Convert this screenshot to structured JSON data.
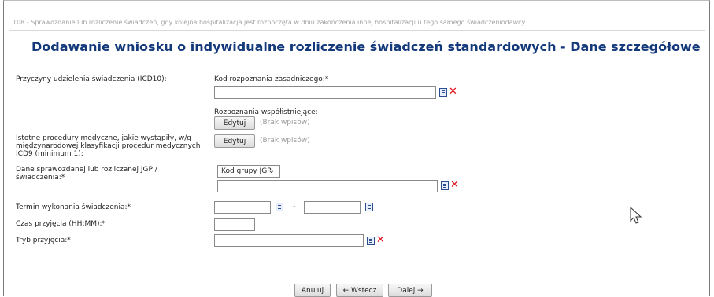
{
  "breadcrumb": "108 - Sprawozdanie lub rozliczenie świadczeń, gdy kolejna hospitalizacja jest rozpoczęta w dniu zakończenia innej hospitalizacji u tego samego świadczeniodawcy",
  "page_title": "Dodawanie wniosku o indywidualne rozliczenie świadczeń standardowych - Dane szczegółowe",
  "icd10": {
    "label": "Przyczyny udzielenia świadczenia (ICD10):",
    "main_label": "Kod rozpoznania zasadniczego:*",
    "main_value": "",
    "coexisting_label": "Rozpoznania współistniejące:",
    "edit_button": "Edytuj",
    "empty_text": "(Brak wpisów)"
  },
  "icd9": {
    "label": "Istotne procedury medyczne, jakie wystąpiły, w/g międzynarodowej klasyfikacji procedur medycznych ICD9 (minimum 1):",
    "edit_button": "Edytuj",
    "empty_text": "(Brak wpisów)"
  },
  "jgp": {
    "label": "Dane sprawozdanej lub rozliczanej JGP / świadczenia:*",
    "select_value": "Kod grupy JGP",
    "code_value": ""
  },
  "term": {
    "label": "Termin wykonania świadczenia:*",
    "separator": "-",
    "from_value": "",
    "to_value": ""
  },
  "admission_time": {
    "label": "Czas przyjęcia (HH:MM):*",
    "value": ""
  },
  "admission_mode": {
    "label": "Tryb przyjęcia:*",
    "value": ""
  },
  "footer": {
    "cancel": "Anuluj",
    "back": "← Wstecz",
    "next": "Dalej →"
  },
  "icons": {
    "list": "list-icon",
    "clear": "clear-icon",
    "cursor": "mouse-pointer-icon"
  }
}
